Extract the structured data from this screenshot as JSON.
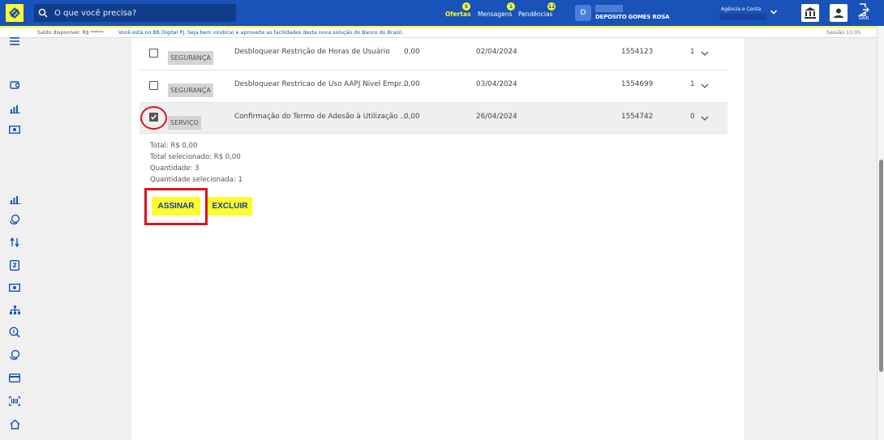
{
  "header": {
    "search_placeholder": "O que você precisa?",
    "nav": [
      {
        "label": "Ofertas",
        "badge": "5"
      },
      {
        "label": "Mensagens",
        "badge": "1"
      },
      {
        "label": "Pendências",
        "badge": "12"
      }
    ],
    "avatar_letter": "D",
    "account_name": "DEPOSITO GOMES ROSA",
    "agency_label": "Agência e Conta",
    "exit_label": "SAIR"
  },
  "subbar": {
    "saldo": "Saldo disponível:  R$ *****",
    "welcome": "Você está no BB Digital PJ. Seja bem vindo(a) e aproveite as facilidades desta nova solução do Banco do Brasil.",
    "sessao": "Sessão 13:05"
  },
  "rows": [
    {
      "checked": false,
      "tag": "SEGURANÇA",
      "description": "Desbloquear Restrição de Horas de Usuário",
      "value": "0,00",
      "date": "02/04/2024",
      "code": "1554123",
      "qty": "1"
    },
    {
      "checked": false,
      "tag": "SEGURANÇA",
      "description": "Desbloquear Restricao de Uso AAPJ Nivel Empr...",
      "value": "0,00",
      "date": "03/04/2024",
      "code": "1554699",
      "qty": "1"
    },
    {
      "checked": true,
      "tag": "SERVIÇO",
      "description": "Confirmação do Termo de Adesão à Utilização ...",
      "value": "0,00",
      "date": "26/04/2024",
      "code": "1554742",
      "qty": "0"
    }
  ],
  "totals": {
    "total": "Total: R$ 0,00",
    "total_selecionado": "Total selecionado: R$ 0,00",
    "quantidade": "Quantidade: 3",
    "quantidade_selecionada": "Quantidade selecionada: 1"
  },
  "actions": {
    "sign_label": "ASSINAR",
    "delete_label": "EXCLUIR"
  },
  "colors": {
    "brand_blue": "#1952b8",
    "brand_yellow": "#fcfc30",
    "highlight_red": "#d7171f"
  }
}
